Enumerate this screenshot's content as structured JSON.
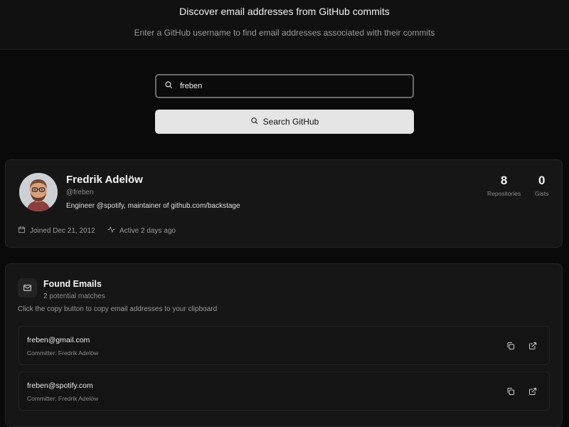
{
  "header": {
    "title": "Discover email addresses from GitHub commits",
    "subtitle": "Enter a GitHub username to find email addresses associated with their commits"
  },
  "search": {
    "value": "freben",
    "button_label": "Search GitHub"
  },
  "profile": {
    "name": "Fredrik Adelöw",
    "handle": "@freben",
    "bio": "Engineer @spotify, maintainer of github.com/backstage",
    "repositories": "8",
    "repositories_label": "Repositories",
    "gists": "0",
    "gists_label": "Gists",
    "joined": "Joined Dec 21, 2012",
    "active": "Active 2 days ago"
  },
  "emails": {
    "title": "Found Emails",
    "count_text": "2 potential matches",
    "hint": "Click the copy button to copy email addresses to your clipboard",
    "items": [
      {
        "address": "freben@gmail.com",
        "committer": "Committer: Fredrik Adelöw"
      },
      {
        "address": "freben@spotify.com",
        "committer": "Committer: Fredrik Adelöw"
      }
    ]
  },
  "colors": {
    "background": "#0a0a0a",
    "card": "#161616",
    "button": "#e5e5e5",
    "muted_text": "#8d8d8d"
  },
  "icons": [
    "search-icon",
    "calendar-icon",
    "activity-icon",
    "mail-icon",
    "copy-icon",
    "external-link-icon"
  ]
}
